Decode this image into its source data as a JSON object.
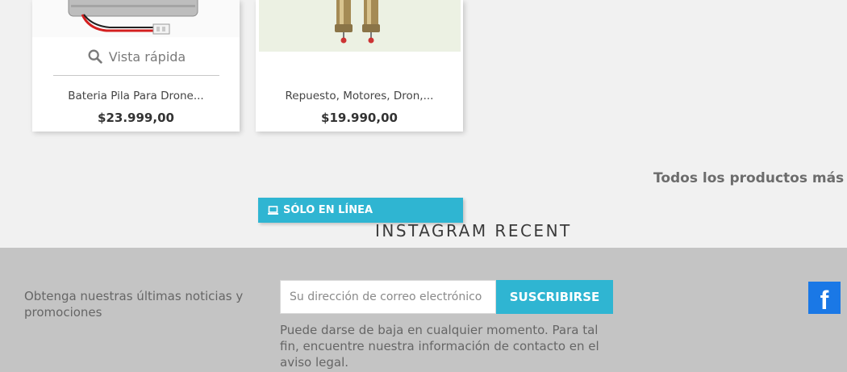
{
  "products": [
    {
      "name": "Bateria Pila Para Drone...",
      "price": "$23.999,00",
      "quick_view": "Vista rápida"
    },
    {
      "name": "Repuesto, Motores, Dron,...",
      "price": "$19.990,00"
    }
  ],
  "all_products_link": "Todos los productos más vendidos",
  "online_badge": "SÓLO EN LÍNEA",
  "instagram_title": "INSTAGRAM RECENT",
  "newsletter": {
    "label": "Obtenga nuestras últimas noticias y promociones",
    "email_placeholder": "Su dirección de correo electrónico",
    "email_value": "",
    "subscribe_label": "SUSCRIBIRSE",
    "unsubscribe_note": "Puede darse de baja en cualquier momento. Para tal fin, encuentre nuestra información de contacto en el aviso legal."
  },
  "social": {
    "facebook_icon": "f"
  },
  "colors": {
    "accent": "#2fb5d2",
    "facebook": "#1a78e6",
    "footer_bg": "#c4c4c4",
    "page_bg": "#f1f1f1"
  }
}
